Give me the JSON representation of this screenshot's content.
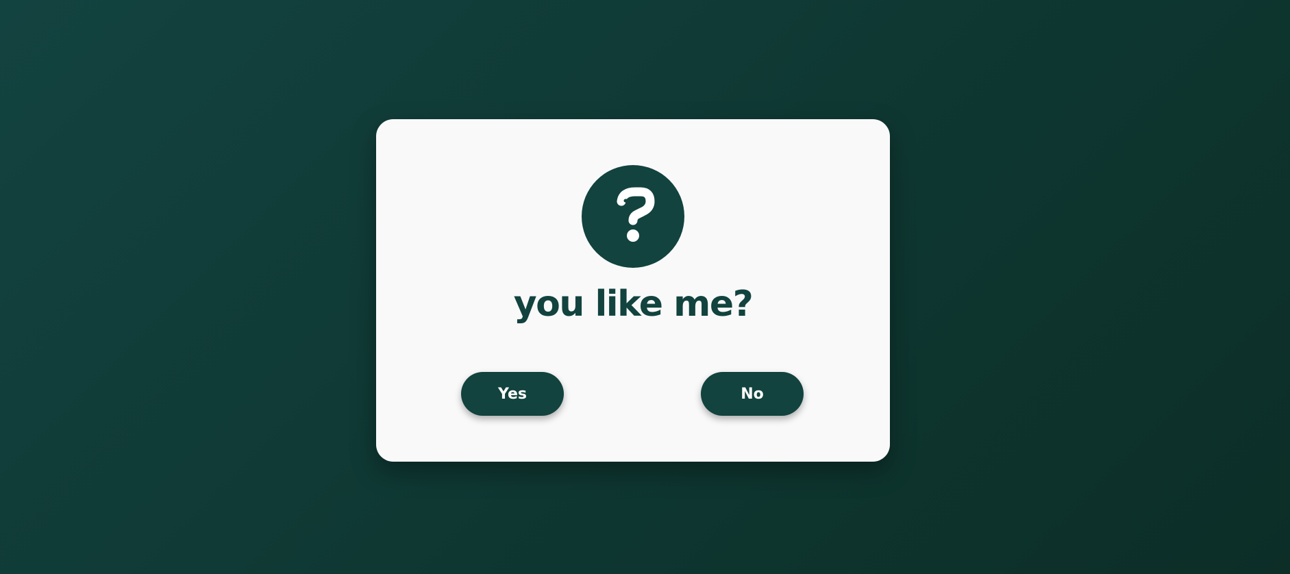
{
  "dialog": {
    "icon": "question-icon",
    "title": "you like me?",
    "yes_label": "Yes",
    "no_label": "No"
  },
  "colors": {
    "background_start": "#134340",
    "background_end": "#0c2e27",
    "card": "#f9f9f9",
    "accent": "#12433e",
    "button_text": "#ffffff"
  }
}
